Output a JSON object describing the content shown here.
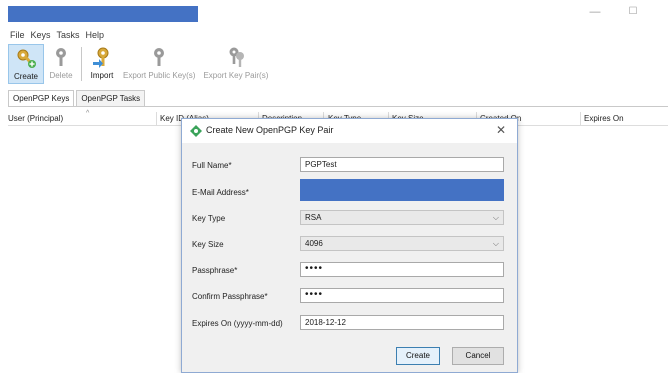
{
  "window": {
    "min_glyph": "—",
    "max_glyph": "☐"
  },
  "menu": [
    "File",
    "Keys",
    "Tasks",
    "Help"
  ],
  "toolbar": {
    "create": "Create",
    "delete": "Delete",
    "import": "Import",
    "export_public": "Export Public Key(s)",
    "export_pair": "Export Key Pair(s)"
  },
  "tabs": {
    "keys": "OpenPGP Keys",
    "tasks": "OpenPGP Tasks"
  },
  "columns": [
    "User (Principal)",
    "Key ID (Alias)",
    "Description",
    "Key Type",
    "Key Size",
    "Created On",
    "Expires On"
  ],
  "dialog": {
    "title": "Create New OpenPGP Key Pair",
    "close": "✕",
    "full_name_label": "Full Name*",
    "full_name_value": "PGPTest",
    "email_label": "E-Mail Address*",
    "email_value": "",
    "key_type_label": "Key Type",
    "key_type_value": "RSA",
    "key_size_label": "Key Size",
    "key_size_value": "4096",
    "passphrase_label": "Passphrase*",
    "passphrase_value": "••••",
    "confirm_label": "Confirm Passphrase*",
    "confirm_value": "••••",
    "expires_label": "Expires On (yyyy-mm-dd)",
    "expires_value": "2018-12-12",
    "create_btn": "Create",
    "cancel_btn": "Cancel",
    "dropdown_chevron": "⌵"
  },
  "colors": {
    "accent": "#4472c4",
    "dialog_bg": "#f0f0f0",
    "key_gold": "#d8a93a",
    "key_grey": "#8c8c8c"
  }
}
